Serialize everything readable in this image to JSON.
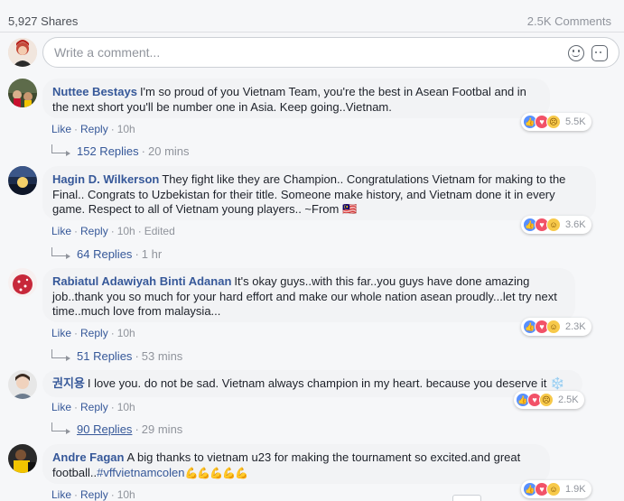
{
  "header": {
    "shares": "5,927 Shares",
    "comments": "2.5K Comments"
  },
  "composer": {
    "placeholder": "Write a comment...",
    "emoji_icon": "emoji-icon",
    "sticker_icon": "sticker-icon"
  },
  "actions": {
    "like": "Like",
    "reply": "Reply",
    "sep": "·"
  },
  "comments": [
    {
      "author": "Nuttee Bestays",
      "text": "I'm so proud of you Vietnam Team, you're the best in Asean Footbal and in the next short you'll be number one in Asia. Keep going..Vietnam.",
      "time": "10h",
      "reactions": [
        "like",
        "love",
        "sad"
      ],
      "reaction_count": "5.5K",
      "replies": "152 Replies",
      "replies_time": "20 mins"
    },
    {
      "author": "Hagin D. Wilkerson",
      "text": "They fight like they are Champion.. Congratulations Vietnam for making to the Final.. Congrats to Uzbekistan for their title. Someone make history, and Vietnam done it in every game. Respect to all of Vietnam young players.. ~From 🇲🇾",
      "time": "10h",
      "edited": "Edited",
      "reactions": [
        "like",
        "love",
        "haha"
      ],
      "reaction_count": "3.6K",
      "replies": "64 Replies",
      "replies_time": "1 hr"
    },
    {
      "author": "Rabiatul Adawiyah Binti Adanan",
      "text": "It's okay guys..with this far..you guys have done amazing job..thank you so much for your hard effort and make our whole nation asean proudly...let try next time..much love from malaysia...",
      "time": "10h",
      "reactions": [
        "like",
        "love",
        "haha"
      ],
      "reaction_count": "2.3K",
      "replies": "51 Replies",
      "replies_time": "53 mins"
    },
    {
      "author": "권지용",
      "text": "I love you. do not be sad. Vietnam always champion in my heart. because you deserve it ❄️",
      "time": "10h",
      "reactions": [
        "like",
        "love",
        "sad"
      ],
      "reaction_count": "2.5K",
      "replies": "90 Replies",
      "replies_time": "29 mins"
    },
    {
      "author": "Andre Fagan",
      "text": "A big thanks to vietnam u23 for making the tournament so excited.and great football..",
      "hashtag": "#vffvietnamcolen",
      "emoji": "💪💪💪💪💪",
      "time": "10h",
      "reactions": [
        "like",
        "love",
        "haha"
      ],
      "reaction_count": "1.9K"
    }
  ],
  "colors": {
    "link": "#365899",
    "muted": "#90949c",
    "bubble": "#f2f3f5",
    "like": "#5890ff",
    "love": "#f25268",
    "emoji": "#f7c94a"
  }
}
